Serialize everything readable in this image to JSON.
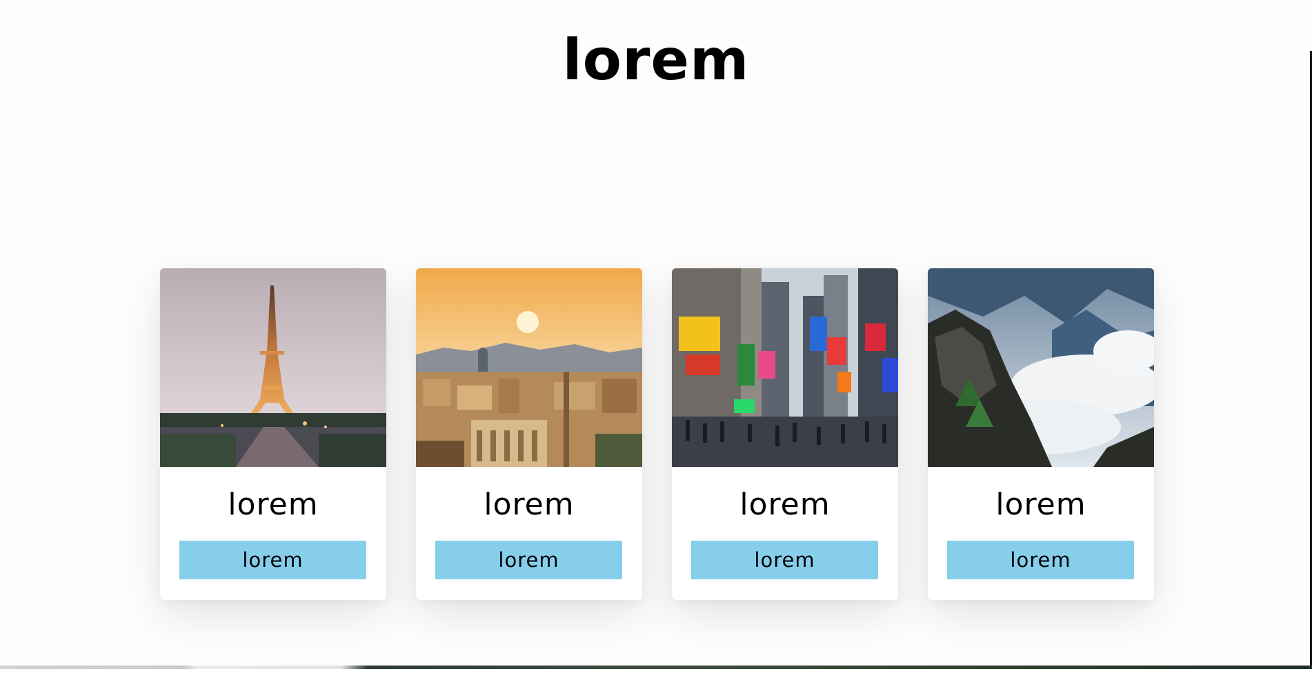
{
  "header": {
    "title": "lorem"
  },
  "cards": [
    {
      "title": "lorem",
      "button_label": "lorem",
      "image": "eiffel-tower-photo"
    },
    {
      "title": "lorem",
      "button_label": "lorem",
      "image": "city-sunset-photo"
    },
    {
      "title": "lorem",
      "button_label": "lorem",
      "image": "times-square-photo"
    },
    {
      "title": "lorem",
      "button_label": "lorem",
      "image": "misty-mountains-photo"
    }
  ],
  "colors": {
    "button_bg": "#87ceeb",
    "text": "#000000",
    "background": "#fdfdfd"
  }
}
